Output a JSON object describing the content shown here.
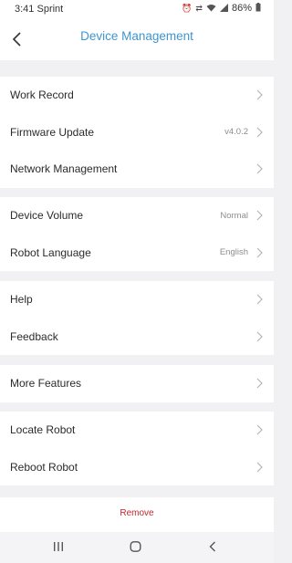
{
  "status": {
    "time": "3:41",
    "carrier": "Sprint",
    "battery": "86%"
  },
  "header": {
    "title": "Device Management"
  },
  "sections": [
    [
      {
        "label": "Work Record",
        "value": ""
      },
      {
        "label": "Firmware Update",
        "value": "v4.0.2"
      },
      {
        "label": "Network Management",
        "value": ""
      }
    ],
    [
      {
        "label": "Device Volume",
        "value": "Normal"
      },
      {
        "label": "Robot Language",
        "value": "English"
      }
    ],
    [
      {
        "label": "Help",
        "value": ""
      },
      {
        "label": "Feedback",
        "value": ""
      }
    ],
    [
      {
        "label": "More Features",
        "value": ""
      }
    ],
    [
      {
        "label": "Locate Robot",
        "value": ""
      },
      {
        "label": "Reboot Robot",
        "value": ""
      }
    ]
  ],
  "remove_label": "Remove",
  "colors": {
    "title": "#3f95cf",
    "remove": "#c0282d",
    "background": "#f1f1f3"
  }
}
